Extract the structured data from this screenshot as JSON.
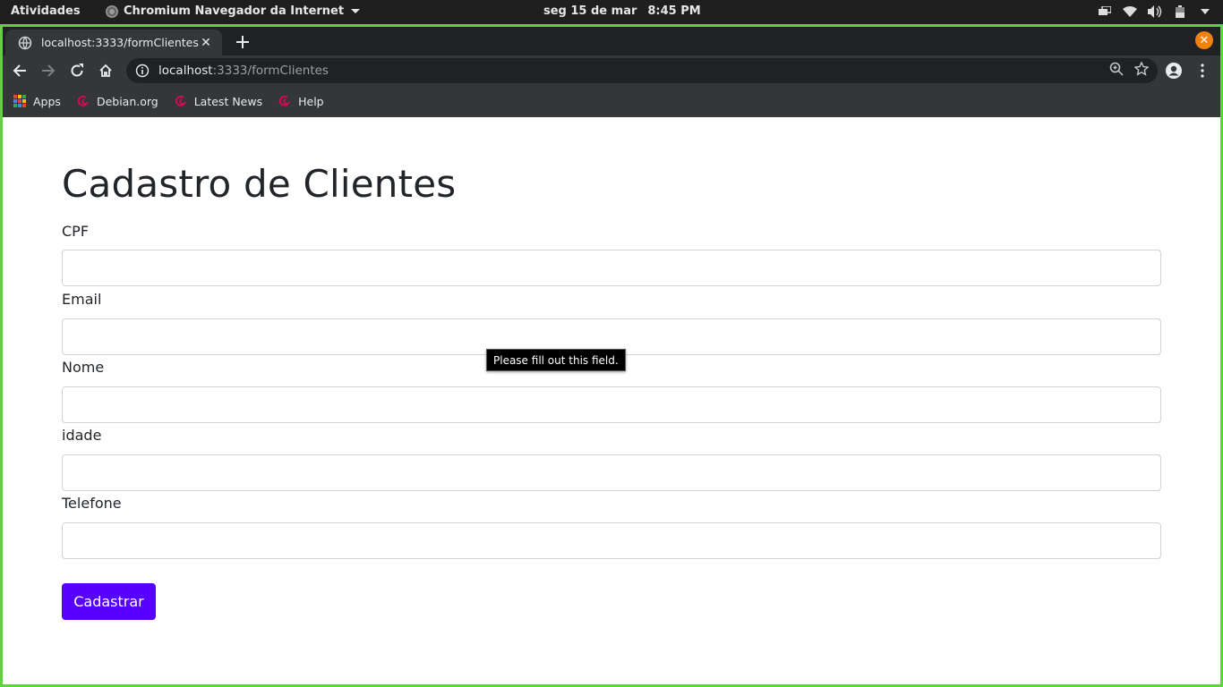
{
  "system": {
    "activities": "Atividades",
    "app_name": "Chromium Navegador da Internet",
    "date": "seg 15 de mar",
    "time": "8:45 PM"
  },
  "browser": {
    "tab_title": "localhost:3333/formClientes",
    "url_host": "localhost",
    "url_path": ":3333/formClientes",
    "bookmarks": [
      {
        "label": "Apps",
        "icon": "apps-grid-icon"
      },
      {
        "label": "Debian.org",
        "icon": "debian-icon"
      },
      {
        "label": "Latest News",
        "icon": "debian-icon"
      },
      {
        "label": "Help",
        "icon": "debian-icon"
      }
    ]
  },
  "form": {
    "title": "Cadastro de Clientes",
    "fields": [
      {
        "label": "CPF",
        "value": ""
      },
      {
        "label": "Email",
        "value": ""
      },
      {
        "label": "Nome",
        "value": ""
      },
      {
        "label": "idade",
        "value": ""
      },
      {
        "label": "Telefone",
        "value": ""
      }
    ],
    "submit_label": "Cadastrar",
    "validation_tooltip": "Please fill out this field."
  },
  "colors": {
    "accent_button": "#5700ff",
    "window_focus_border": "#5fd33b",
    "close_button": "#f0820f"
  }
}
